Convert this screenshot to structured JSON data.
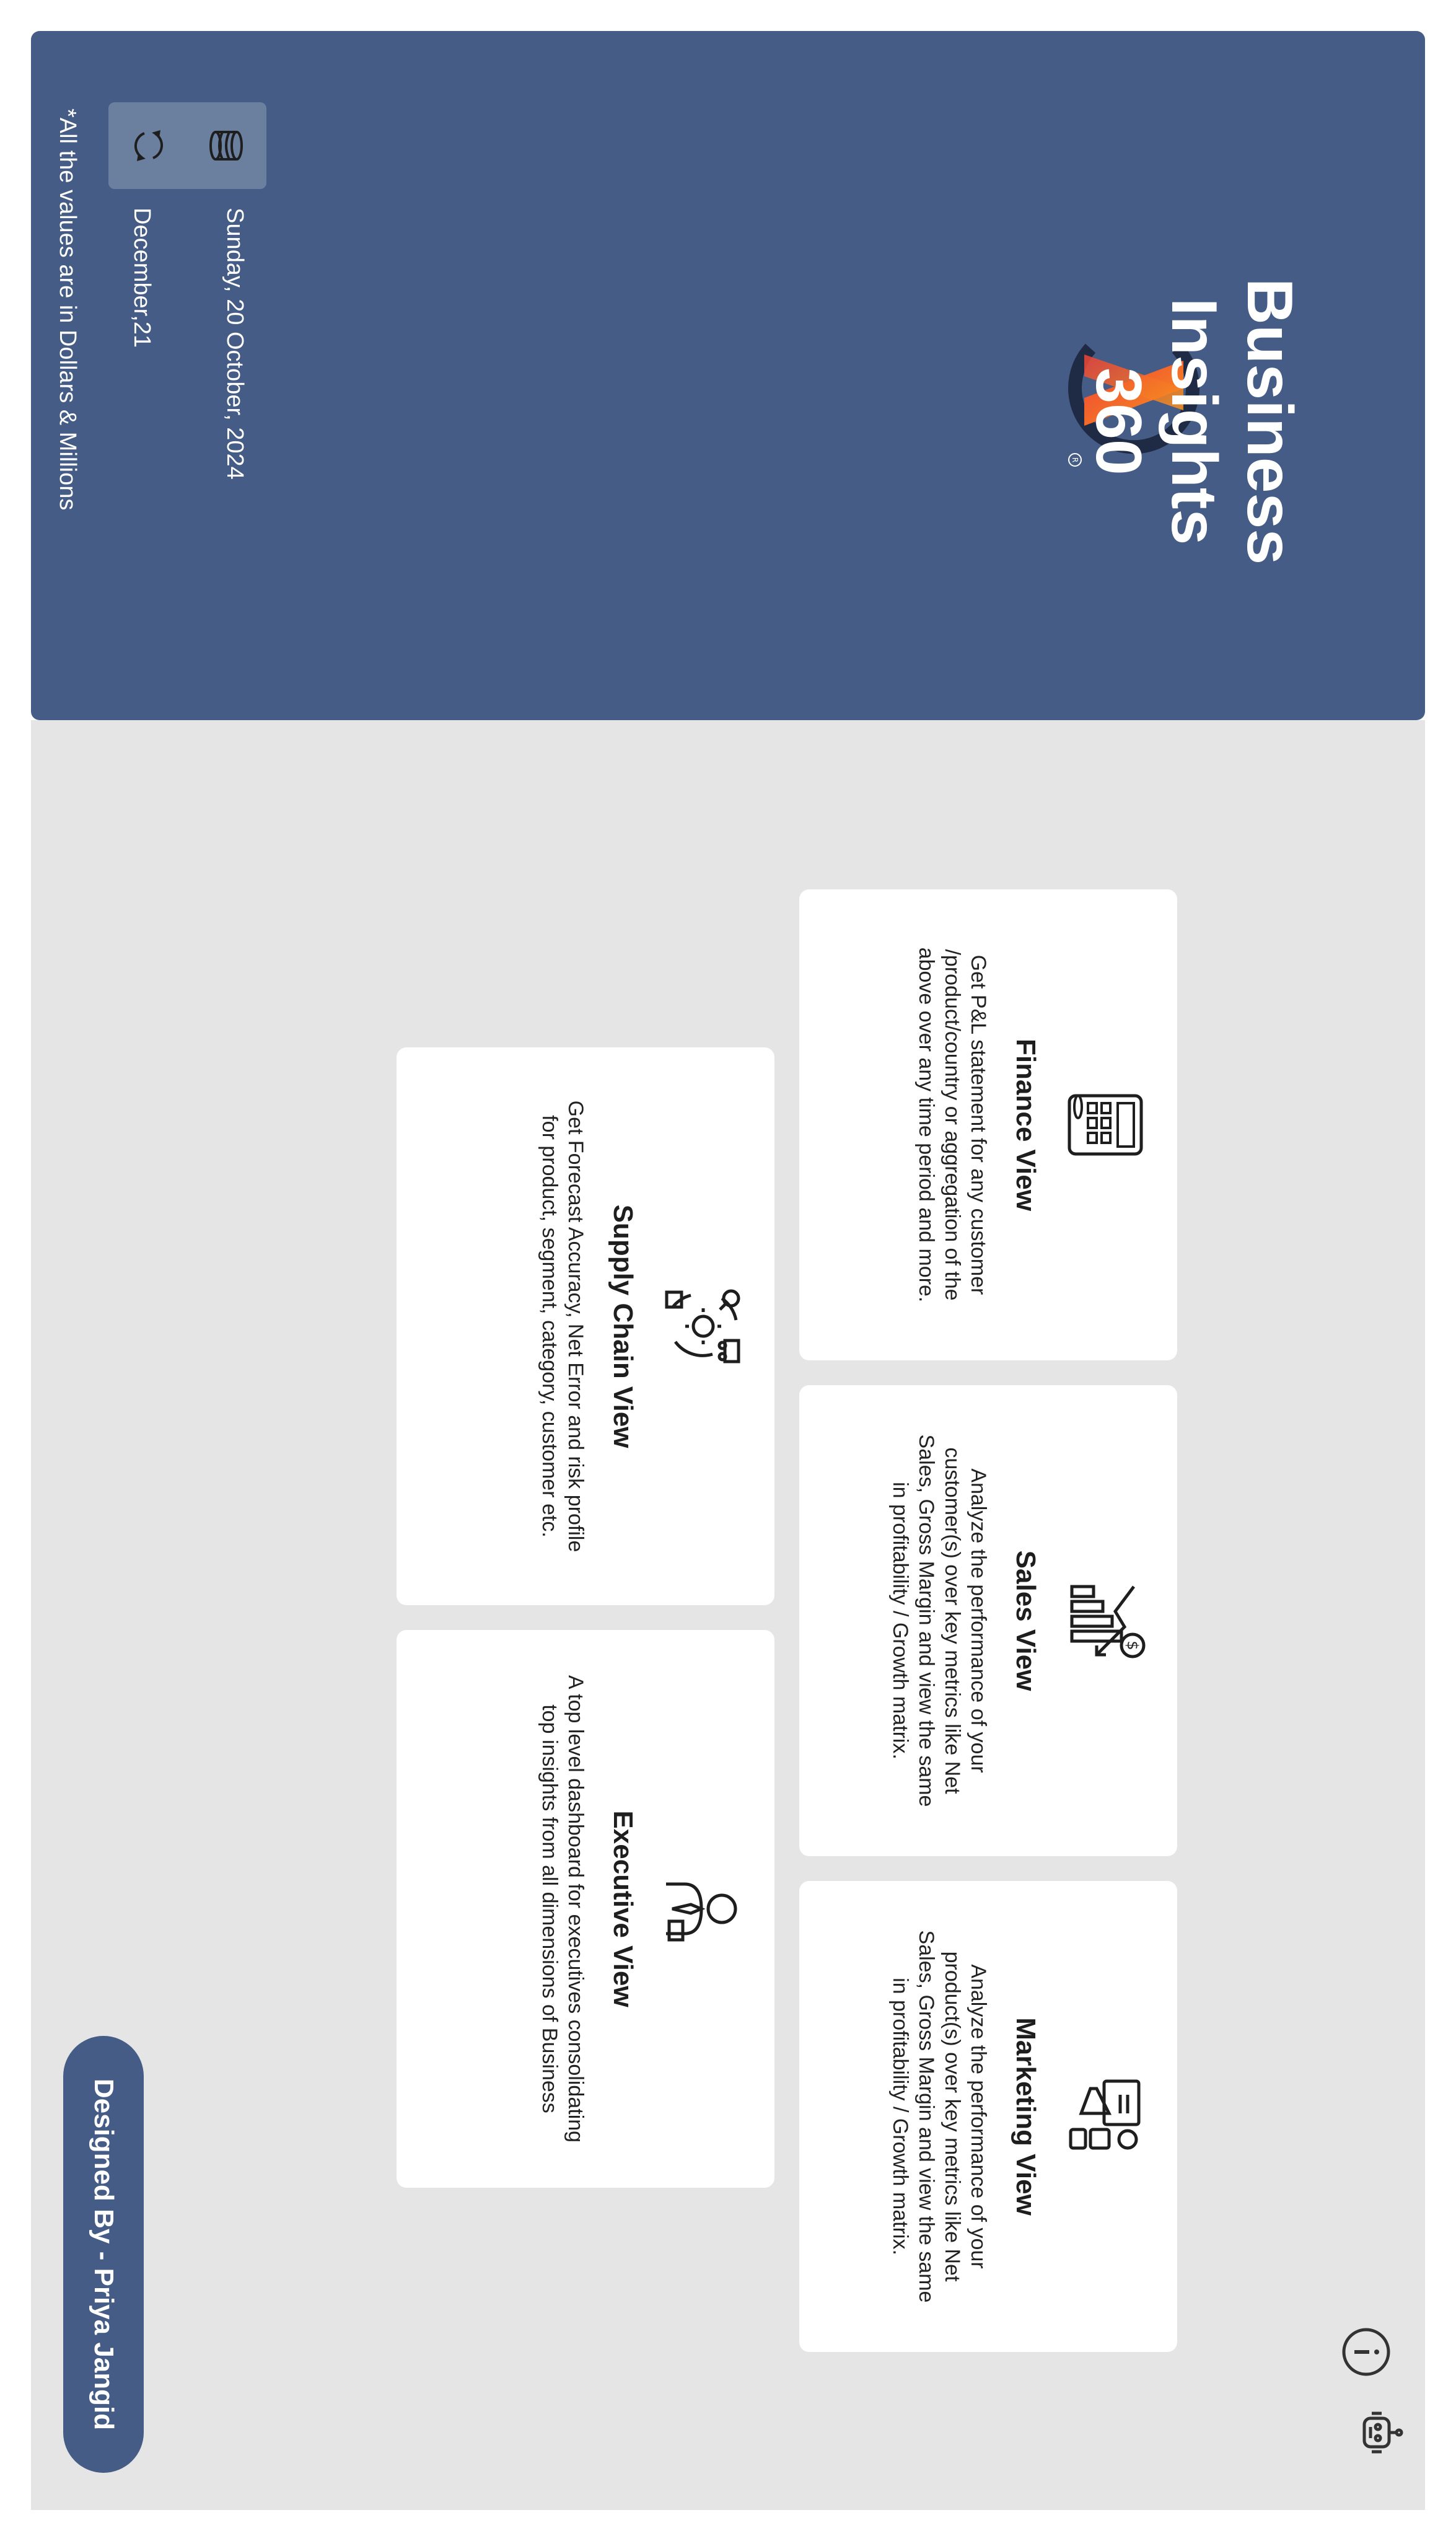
{
  "header": {
    "title_line1": "Business Insights",
    "title_line2": "360",
    "date": "Sunday, 20 October, 2024",
    "period": "December,21",
    "note": "*All the values are in Dollars & Millions",
    "logo_icon": "brand-logo-icon",
    "toolbar": [
      {
        "icon": "data-table-icon"
      },
      {
        "icon": "refresh-icon"
      }
    ]
  },
  "cards": {
    "finance": {
      "title": "Finance View",
      "description": "Get P&L statement for any customer /product/country or aggregation of the above over any time period and more.",
      "icon": "finance-calculator-icon"
    },
    "sales": {
      "title": "Sales View",
      "description": "Analyze the performance of your customer(s) over key metrics like Net Sales, Gross Margin and view the same in profitability / Growth matrix.",
      "icon": "sales-chart-icon"
    },
    "marketing": {
      "title": "Marketing View",
      "description": "Analyze the performance of your product(s) over key metrics like Net Sales, Gross Margin and view the same in profitability / Growth matrix.",
      "icon": "marketing-megaphone-icon"
    },
    "supply_chain": {
      "title": "Supply Chain View",
      "description": "Get Forecast Accuracy, Net Error and risk profile for product, segment, category, customer etc.",
      "icon": "supply-chain-icon"
    },
    "executive": {
      "title": "Executive View",
      "description": "A top level dashboard for executives consolidating top insights from all dimensions of Business",
      "icon": "executive-icon"
    }
  },
  "footer": {
    "designed_by": "Designed By - Priya Jangid",
    "info_icon": "info-icon",
    "assistant_icon": "chatbot-icon"
  },
  "colors": {
    "banner": "#445c86",
    "content_bg": "#e5e5e5",
    "logo_orange": "#ef4136",
    "logo_dark": "#1f2a44"
  }
}
